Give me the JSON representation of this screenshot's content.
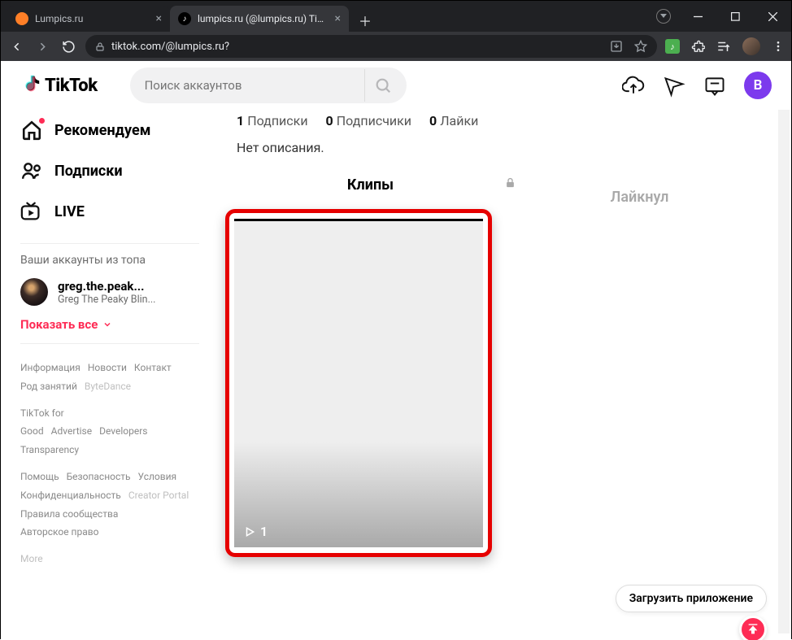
{
  "browser": {
    "tabs": [
      {
        "title": "Lumpics.ru"
      },
      {
        "title": "lumpics.ru (@lumpics.ru) TikTok |"
      }
    ],
    "url": "tiktok.com/@lumpics.ru?"
  },
  "header": {
    "logo_text": "TikTok",
    "search_placeholder": "Поиск аккаунтов",
    "profile_initial": "B"
  },
  "sidebar": {
    "nav": {
      "recommended": "Рекомендуем",
      "following": "Подписки",
      "live": "LIVE"
    },
    "accounts_heading": "Ваши аккаунты из топа",
    "accounts": [
      {
        "username": "greg.the.peak...",
        "displayname": "Greg The Peaky Blin..."
      }
    ],
    "show_all": "Показать все",
    "footer": {
      "l1": [
        "Информация",
        "Новости",
        "Контакт"
      ],
      "l2a": "Род занятий",
      "l2b": "ByteDance",
      "l3": [
        "TikTok for Good",
        "Advertise",
        "Developers"
      ],
      "l4": "Transparency",
      "l5": [
        "Помощь",
        "Безопасность",
        "Условия"
      ],
      "l6a": "Конфиденциальность",
      "l6b": "Creator Portal",
      "l7": "Правила сообщества",
      "l8": "Авторское право",
      "more": "More"
    }
  },
  "profile": {
    "stats": {
      "following_count": "1",
      "following_label": "Подписки",
      "followers_count": "0",
      "followers_label": "Подписчики",
      "likes_count": "0",
      "likes_label": "Лайки"
    },
    "bio": "Нет описания.",
    "tabs": {
      "videos": "Клипы",
      "liked": "Лайкнул"
    },
    "video_views": "1"
  },
  "floating": {
    "download_app": "Загрузить приложение"
  }
}
